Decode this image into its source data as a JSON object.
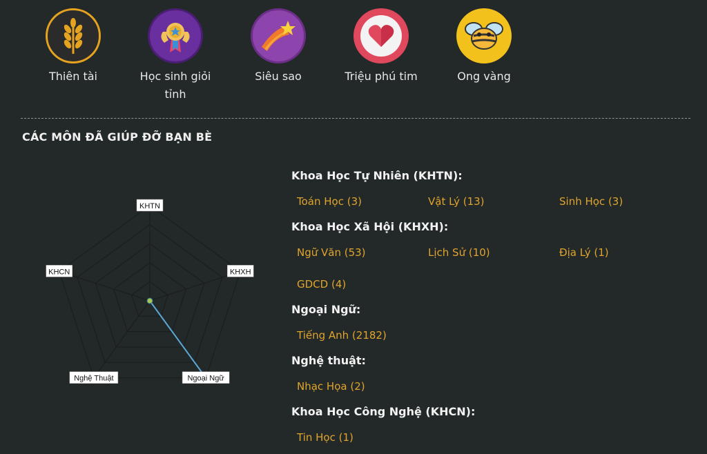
{
  "badges": [
    {
      "label": "Thiên tài",
      "icon": "wheat-icon",
      "color": "#e5a320"
    },
    {
      "label": "Học sinh giỏi tỉnh",
      "icon": "medal-icon",
      "color": "#7c3fb0"
    },
    {
      "label": "Siêu sao",
      "icon": "shooting-star-icon",
      "color": "#8e44ad"
    },
    {
      "label": "Triệu phú tim",
      "icon": "heart-icon",
      "color": "#e0485e"
    },
    {
      "label": "Ong vàng",
      "icon": "bee-icon",
      "color": "#f2c11c"
    }
  ],
  "section_title": "CÁC MÔN ĐÃ GIÚP ĐỠ BẠN BÈ",
  "radar": {
    "axes": [
      "KHTN",
      "KHXH",
      "Ngoại Ngữ",
      "Nghệ Thuật",
      "KHCN"
    ],
    "values": [
      0,
      0,
      1,
      0,
      0
    ],
    "line_color": "#5aa9d6",
    "point_color": "#a8c55a"
  },
  "categories": [
    {
      "title": "Khoa Học Tự Nhiên (KHTN):",
      "subjects": [
        "Toán Học (3)",
        "Vật Lý (13)",
        "Sinh Học (3)"
      ]
    },
    {
      "title": "Khoa Học Xã Hội (KHXH):",
      "subjects": [
        "Ngữ Văn (53)",
        "Lịch Sử (10)",
        "Địa Lý (1)",
        "GDCD (4)"
      ]
    },
    {
      "title": "Ngoại Ngữ:",
      "subjects": [
        "Tiếng Anh (2182)"
      ]
    },
    {
      "title": "Nghệ thuật:",
      "subjects": [
        "Nhạc Họa (2)"
      ]
    },
    {
      "title": "Khoa Học Công Nghệ (KHCN):",
      "subjects": [
        "Tin Học (1)"
      ]
    }
  ],
  "accent_color": "#e0a52c"
}
